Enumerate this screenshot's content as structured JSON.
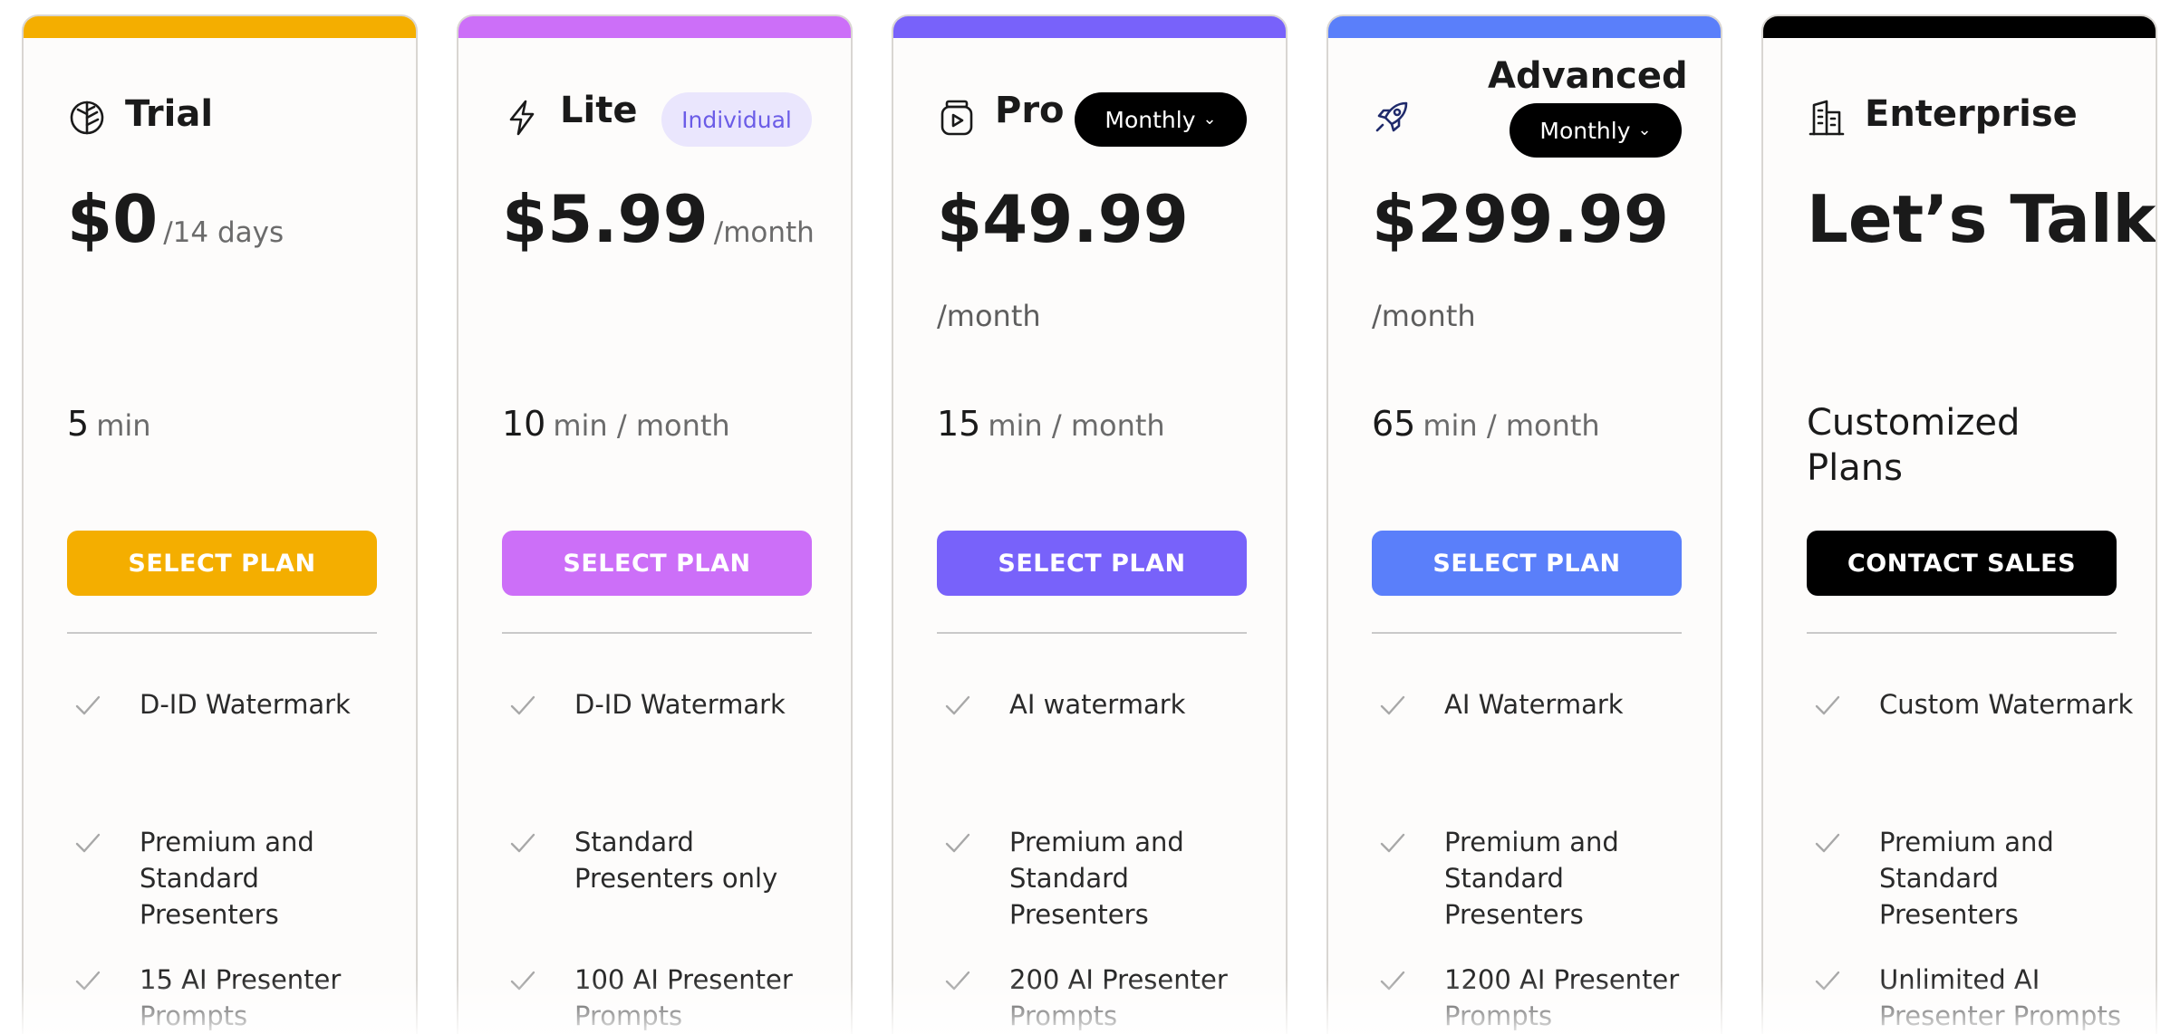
{
  "colors": {
    "trial": "#f4ae00",
    "lite": "#cc6ff8",
    "pro": "#7862fa",
    "advanced": "#5a7ffa",
    "enterprise": "#000000"
  },
  "plans": [
    {
      "name": "Trial",
      "icon": "leaf-icon",
      "price": "$0",
      "period": "/14 days",
      "minutes": "5",
      "minutes_unit": "min",
      "button": "SELECT PLAN",
      "features": [
        "D-ID Watermark",
        "Premium and Standard Presenters",
        "15 AI Presenter Prompts"
      ]
    },
    {
      "name": "Lite",
      "icon": "lightning-icon",
      "badge": "Individual",
      "price": "$5.99",
      "period": "/month",
      "minutes": "10",
      "minutes_unit": "min / month",
      "button": "SELECT PLAN",
      "features": [
        "D-ID Watermark",
        "Standard Presenters only",
        "100 AI Presenter Prompts"
      ]
    },
    {
      "name": "Pro",
      "icon": "video-jar-icon",
      "billing": "Monthly",
      "price": "$49.99",
      "period": "/month",
      "minutes": "15",
      "minutes_unit": "min / month",
      "button": "SELECT PLAN",
      "features": [
        "AI watermark",
        "Premium and Standard Presenters",
        "200 AI Presenter Prompts"
      ]
    },
    {
      "name": "Advanced",
      "icon": "rocket-icon",
      "billing": "Monthly",
      "price": "$299.99",
      "period": "/month",
      "minutes": "65",
      "minutes_unit": "min / month",
      "button": "SELECT PLAN",
      "features": [
        "AI Watermark",
        "Premium and Standard Presenters",
        "1200 AI Presenter Prompts"
      ]
    },
    {
      "name": "Enterprise",
      "icon": "buildings-icon",
      "price": "Let’s Talk",
      "custom": "Customized Plans",
      "button": "CONTACT SALES",
      "features": [
        "Custom Watermark",
        "Premium and Standard Presenters",
        "Unlimited AI Presenter Prompts"
      ]
    }
  ],
  "icons": {
    "check": "check-icon",
    "chevron": "chevron-down-icon"
  }
}
